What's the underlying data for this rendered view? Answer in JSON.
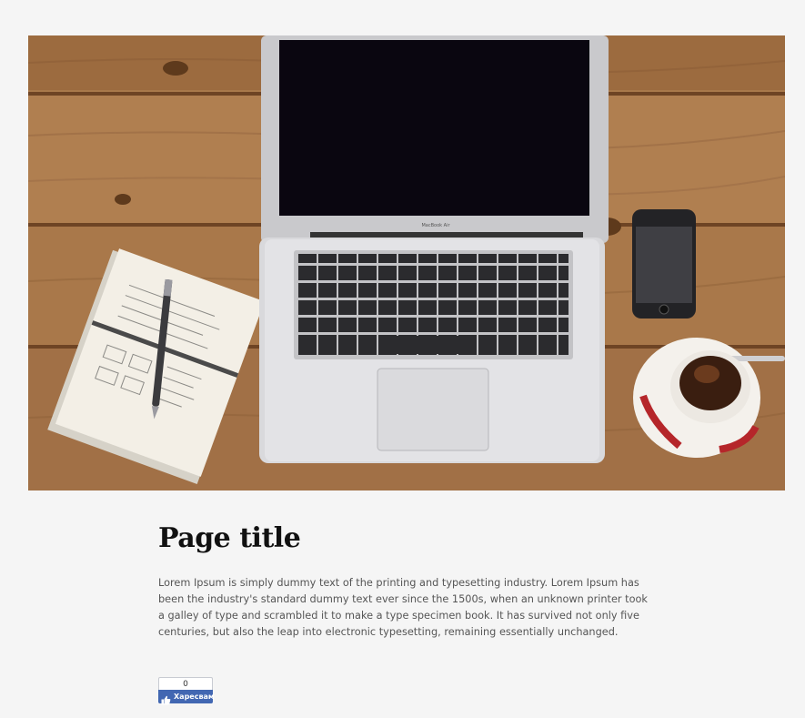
{
  "hero": {
    "image_icon": "laptop-workspace-photo",
    "laptop_brand_text": "MacBook Air"
  },
  "article": {
    "title": "Page title",
    "body": "Lorem Ipsum is simply dummy text of the printing and typesetting industry. Lorem Ipsum has been the industry's standard dummy text ever since the 1500s, when an unknown printer took a galley of type and scrambled it to make a type specimen book. It has survived not only five centuries, but also the leap into electronic typesetting, remaining essentially unchanged."
  },
  "like_widget": {
    "count": "0",
    "label": "Харесвам",
    "icon": "thumbs-up-icon",
    "color": "#4267b2"
  }
}
